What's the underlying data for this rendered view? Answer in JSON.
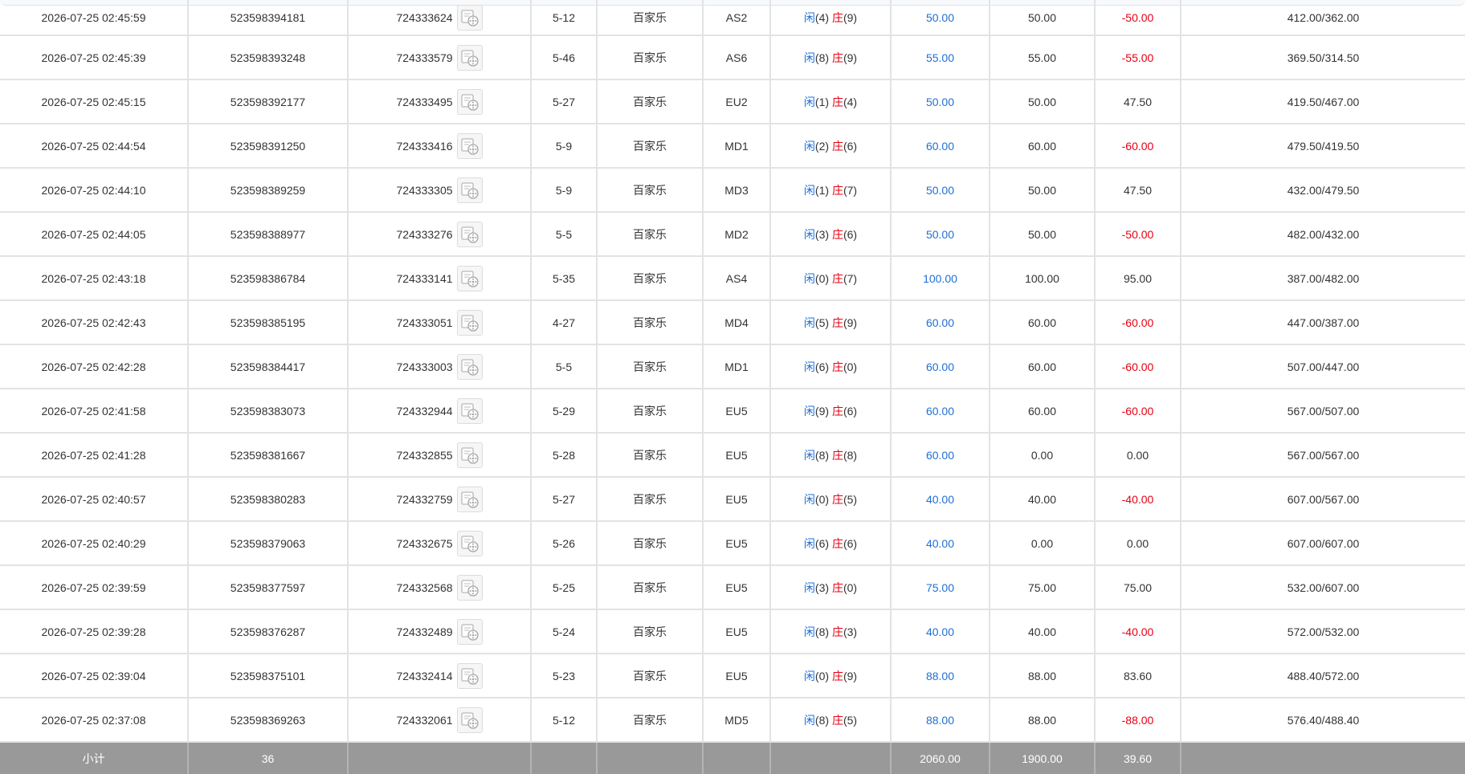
{
  "player_label": "闲",
  "banker_label": "庄",
  "rows": [
    {
      "time": "2026-07-25 02:45:59",
      "bet_id": "523598394181",
      "round_id": "724333624",
      "shoe": "5-12",
      "game": "百家乐",
      "table": "AS2",
      "player_points": "(4)",
      "banker_points": "(9)",
      "bet": "50.00",
      "valid_bet": "50.00",
      "win_loss": "-50.00",
      "win_loss_negative": true,
      "balance": "412.00/362.00"
    },
    {
      "time": "2026-07-25 02:45:39",
      "bet_id": "523598393248",
      "round_id": "724333579",
      "shoe": "5-46",
      "game": "百家乐",
      "table": "AS6",
      "player_points": "(8)",
      "banker_points": "(9)",
      "bet": "55.00",
      "valid_bet": "55.00",
      "win_loss": "-55.00",
      "win_loss_negative": true,
      "balance": "369.50/314.50"
    },
    {
      "time": "2026-07-25 02:45:15",
      "bet_id": "523598392177",
      "round_id": "724333495",
      "shoe": "5-27",
      "game": "百家乐",
      "table": "EU2",
      "player_points": "(1)",
      "banker_points": "(4)",
      "bet": "50.00",
      "valid_bet": "50.00",
      "win_loss": "47.50",
      "win_loss_negative": false,
      "balance": "419.50/467.00"
    },
    {
      "time": "2026-07-25 02:44:54",
      "bet_id": "523598391250",
      "round_id": "724333416",
      "shoe": "5-9",
      "game": "百家乐",
      "table": "MD1",
      "player_points": "(2)",
      "banker_points": "(6)",
      "bet": "60.00",
      "valid_bet": "60.00",
      "win_loss": "-60.00",
      "win_loss_negative": true,
      "balance": "479.50/419.50"
    },
    {
      "time": "2026-07-25 02:44:10",
      "bet_id": "523598389259",
      "round_id": "724333305",
      "shoe": "5-9",
      "game": "百家乐",
      "table": "MD3",
      "player_points": "(1)",
      "banker_points": "(7)",
      "bet": "50.00",
      "valid_bet": "50.00",
      "win_loss": "47.50",
      "win_loss_negative": false,
      "balance": "432.00/479.50"
    },
    {
      "time": "2026-07-25 02:44:05",
      "bet_id": "523598388977",
      "round_id": "724333276",
      "shoe": "5-5",
      "game": "百家乐",
      "table": "MD2",
      "player_points": "(3)",
      "banker_points": "(6)",
      "bet": "50.00",
      "valid_bet": "50.00",
      "win_loss": "-50.00",
      "win_loss_negative": true,
      "balance": "482.00/432.00"
    },
    {
      "time": "2026-07-25 02:43:18",
      "bet_id": "523598386784",
      "round_id": "724333141",
      "shoe": "5-35",
      "game": "百家乐",
      "table": "AS4",
      "player_points": "(0)",
      "banker_points": "(7)",
      "bet": "100.00",
      "valid_bet": "100.00",
      "win_loss": "95.00",
      "win_loss_negative": false,
      "balance": "387.00/482.00"
    },
    {
      "time": "2026-07-25 02:42:43",
      "bet_id": "523598385195",
      "round_id": "724333051",
      "shoe": "4-27",
      "game": "百家乐",
      "table": "MD4",
      "player_points": "(5)",
      "banker_points": "(9)",
      "bet": "60.00",
      "valid_bet": "60.00",
      "win_loss": "-60.00",
      "win_loss_negative": true,
      "balance": "447.00/387.00"
    },
    {
      "time": "2026-07-25 02:42:28",
      "bet_id": "523598384417",
      "round_id": "724333003",
      "shoe": "5-5",
      "game": "百家乐",
      "table": "MD1",
      "player_points": "(6)",
      "banker_points": "(0)",
      "bet": "60.00",
      "valid_bet": "60.00",
      "win_loss": "-60.00",
      "win_loss_negative": true,
      "balance": "507.00/447.00"
    },
    {
      "time": "2026-07-25 02:41:58",
      "bet_id": "523598383073",
      "round_id": "724332944",
      "shoe": "5-29",
      "game": "百家乐",
      "table": "EU5",
      "player_points": "(9)",
      "banker_points": "(6)",
      "bet": "60.00",
      "valid_bet": "60.00",
      "win_loss": "-60.00",
      "win_loss_negative": true,
      "balance": "567.00/507.00"
    },
    {
      "time": "2026-07-25 02:41:28",
      "bet_id": "523598381667",
      "round_id": "724332855",
      "shoe": "5-28",
      "game": "百家乐",
      "table": "EU5",
      "player_points": "(8)",
      "banker_points": "(8)",
      "bet": "60.00",
      "valid_bet": "0.00",
      "win_loss": "0.00",
      "win_loss_negative": false,
      "balance": "567.00/567.00"
    },
    {
      "time": "2026-07-25 02:40:57",
      "bet_id": "523598380283",
      "round_id": "724332759",
      "shoe": "5-27",
      "game": "百家乐",
      "table": "EU5",
      "player_points": "(0)",
      "banker_points": "(5)",
      "bet": "40.00",
      "valid_bet": "40.00",
      "win_loss": "-40.00",
      "win_loss_negative": true,
      "balance": "607.00/567.00"
    },
    {
      "time": "2026-07-25 02:40:29",
      "bet_id": "523598379063",
      "round_id": "724332675",
      "shoe": "5-26",
      "game": "百家乐",
      "table": "EU5",
      "player_points": "(6)",
      "banker_points": "(6)",
      "bet": "40.00",
      "valid_bet": "0.00",
      "win_loss": "0.00",
      "win_loss_negative": false,
      "balance": "607.00/607.00"
    },
    {
      "time": "2026-07-25 02:39:59",
      "bet_id": "523598377597",
      "round_id": "724332568",
      "shoe": "5-25",
      "game": "百家乐",
      "table": "EU5",
      "player_points": "(3)",
      "banker_points": "(0)",
      "bet": "75.00",
      "valid_bet": "75.00",
      "win_loss": "75.00",
      "win_loss_negative": false,
      "balance": "532.00/607.00"
    },
    {
      "time": "2026-07-25 02:39:28",
      "bet_id": "523598376287",
      "round_id": "724332489",
      "shoe": "5-24",
      "game": "百家乐",
      "table": "EU5",
      "player_points": "(8)",
      "banker_points": "(3)",
      "bet": "40.00",
      "valid_bet": "40.00",
      "win_loss": "-40.00",
      "win_loss_negative": true,
      "balance": "572.00/532.00"
    },
    {
      "time": "2026-07-25 02:39:04",
      "bet_id": "523598375101",
      "round_id": "724332414",
      "shoe": "5-23",
      "game": "百家乐",
      "table": "EU5",
      "player_points": "(0)",
      "banker_points": "(9)",
      "bet": "88.00",
      "valid_bet": "88.00",
      "win_loss": "83.60",
      "win_loss_negative": false,
      "balance": "488.40/572.00"
    },
    {
      "time": "2026-07-25 02:37:08",
      "bet_id": "523598369263",
      "round_id": "724332061",
      "shoe": "5-12",
      "game": "百家乐",
      "table": "MD5",
      "player_points": "(8)",
      "banker_points": "(5)",
      "bet": "88.00",
      "valid_bet": "88.00",
      "win_loss": "-88.00",
      "win_loss_negative": true,
      "balance": "576.40/488.40"
    }
  ],
  "subtotal": {
    "label": "小计",
    "count": "36",
    "bet": "2060.00",
    "valid_bet": "1900.00",
    "win_loss": "39.60"
  },
  "colors": {
    "bet_amount": "#1f6fd6",
    "negative": "#e60012",
    "subtotal_bg": "#999999",
    "grid": "#e3e3e3"
  },
  "icons": {
    "replay": "video-replay-icon"
  }
}
